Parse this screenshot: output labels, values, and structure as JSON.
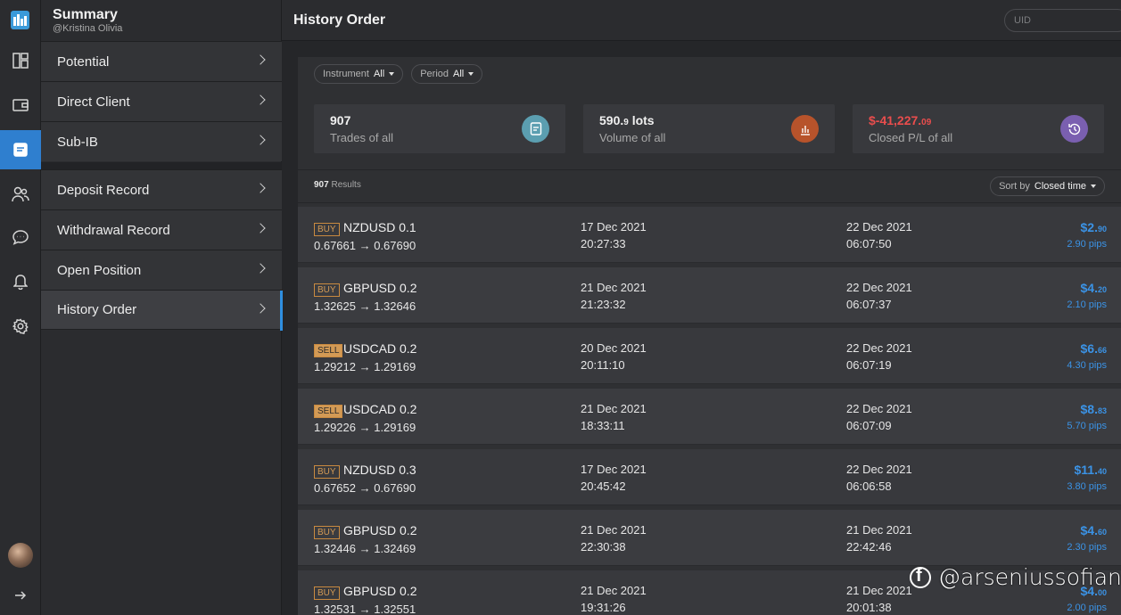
{
  "sidebar": {
    "title": "Summary",
    "subtitle": "@Kristina Olivia",
    "items": [
      {
        "label": "Potential"
      },
      {
        "label": "Direct Client"
      },
      {
        "label": "Sub-IB"
      },
      {
        "label": "Deposit Record"
      },
      {
        "label": "Withdrawal Record"
      },
      {
        "label": "Open Position"
      },
      {
        "label": "History Order"
      }
    ]
  },
  "rail": {
    "icons": [
      "logo-icon",
      "dashboard-icon",
      "wallet-icon",
      "document-icon",
      "users-icon",
      "chat-icon",
      "bell-icon",
      "settings-icon",
      "avatar",
      "arrow-right-icon"
    ]
  },
  "header": {
    "title": "History Order",
    "uid_placeholder": "UID"
  },
  "filters": {
    "instrument_label": "Instrument",
    "instrument_value": "All",
    "period_label": "Period",
    "period_value": "All"
  },
  "stats": {
    "trades": {
      "value": "907",
      "label": "Trades of all",
      "color": "#5b9eb0"
    },
    "volume": {
      "value_main": "590.",
      "value_dec": "9",
      "value_unit": " lots",
      "label": "Volume of all",
      "color": "#b7532b"
    },
    "pl": {
      "value_main": "$-41,227.",
      "value_dec": "09",
      "label": "Closed P/L of all",
      "color": "#7a5fb0"
    }
  },
  "results": {
    "count": "907",
    "label": "Results",
    "sort_label": "Sort by",
    "sort_value": "Closed time"
  },
  "orders": [
    {
      "side": "BUY",
      "pair": "NZDUSD 0.1",
      "prices": "0.67661 → 0.67690",
      "open_date": "17 Dec 2021",
      "open_time": "20:27:33",
      "close_date": "22 Dec 2021",
      "close_time": "06:07:50",
      "pl_main": "$2.",
      "pl_dec": "90",
      "pips": "2.90 pips"
    },
    {
      "side": "BUY",
      "pair": "GBPUSD 0.2",
      "prices": "1.32625 → 1.32646",
      "open_date": "21 Dec 2021",
      "open_time": "21:23:32",
      "close_date": "22 Dec 2021",
      "close_time": "06:07:37",
      "pl_main": "$4.",
      "pl_dec": "20",
      "pips": "2.10 pips"
    },
    {
      "side": "SELL",
      "pair": "USDCAD 0.2",
      "prices": "1.29212 → 1.29169",
      "open_date": "20 Dec 2021",
      "open_time": "20:11:10",
      "close_date": "22 Dec 2021",
      "close_time": "06:07:19",
      "pl_main": "$6.",
      "pl_dec": "66",
      "pips": "4.30 pips"
    },
    {
      "side": "SELL",
      "pair": "USDCAD 0.2",
      "prices": "1.29226 → 1.29169",
      "open_date": "21 Dec 2021",
      "open_time": "18:33:11",
      "close_date": "22 Dec 2021",
      "close_time": "06:07:09",
      "pl_main": "$8.",
      "pl_dec": "83",
      "pips": "5.70 pips"
    },
    {
      "side": "BUY",
      "pair": "NZDUSD 0.3",
      "prices": "0.67652 → 0.67690",
      "open_date": "17 Dec 2021",
      "open_time": "20:45:42",
      "close_date": "22 Dec 2021",
      "close_time": "06:06:58",
      "pl_main": "$11.",
      "pl_dec": "40",
      "pips": "3.80 pips"
    },
    {
      "side": "BUY",
      "pair": "GBPUSD 0.2",
      "prices": "1.32446 → 1.32469",
      "open_date": "21 Dec 2021",
      "open_time": "22:30:38",
      "close_date": "21 Dec 2021",
      "close_time": "22:42:46",
      "pl_main": "$4.",
      "pl_dec": "60",
      "pips": "2.30 pips"
    },
    {
      "side": "BUY",
      "pair": "GBPUSD 0.2",
      "prices": "1.32531 → 1.32551",
      "open_date": "21 Dec 2021",
      "open_time": "19:31:26",
      "close_date": "21 Dec 2021",
      "close_time": "20:01:38",
      "pl_main": "$4.",
      "pl_dec": "00",
      "pips": "2.00 pips"
    }
  ],
  "watermark": "@arseniussofian"
}
